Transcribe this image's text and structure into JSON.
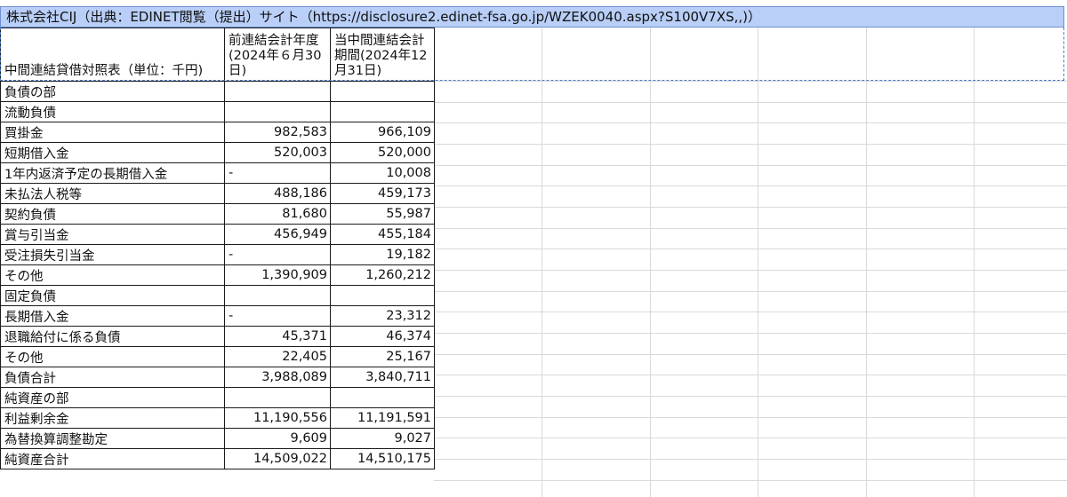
{
  "title": "株式会社CIJ（出典：EDINET閲覧（提出）サイト（https://disclosure2.edinet-fsa.go.jp/WZEK0040.aspx?S100V7XS,,)）",
  "header": {
    "c0": "中間連結貸借対照表（単位：千円)",
    "c1": "前連結会計年度(2024年６月30日)",
    "c2": "当中間連結会計期間(2024年12月31日)"
  },
  "rows": [
    {
      "label": "負債の部",
      "prev": "",
      "curr": ""
    },
    {
      "label": "流動負債",
      "prev": "",
      "curr": ""
    },
    {
      "label": "買掛金",
      "prev": "982,583",
      "curr": "966,109"
    },
    {
      "label": "短期借入金",
      "prev": "520,003",
      "curr": "520,000"
    },
    {
      "label": "1年内返済予定の長期借入金",
      "prev": "-",
      "curr": "10,008"
    },
    {
      "label": "未払法人税等",
      "prev": "488,186",
      "curr": "459,173"
    },
    {
      "label": "契約負債",
      "prev": "81,680",
      "curr": "55,987"
    },
    {
      "label": "賞与引当金",
      "prev": "456,949",
      "curr": "455,184"
    },
    {
      "label": "受注損失引当金",
      "prev": "-",
      "curr": "19,182"
    },
    {
      "label": "その他",
      "prev": "1,390,909",
      "curr": "1,260,212"
    },
    {
      "label": "固定負債",
      "prev": "",
      "curr": ""
    },
    {
      "label": "長期借入金",
      "prev": "-",
      "curr": "23,312"
    },
    {
      "label": "退職給付に係る負債",
      "prev": "45,371",
      "curr": "46,374"
    },
    {
      "label": "その他",
      "prev": "22,405",
      "curr": "25,167"
    },
    {
      "label": "負債合計",
      "prev": "3,988,089",
      "curr": "3,840,711"
    },
    {
      "label": "純資産の部",
      "prev": "",
      "curr": ""
    },
    {
      "label": "利益剰余金",
      "prev": "11,190,556",
      "curr": "11,191,591"
    },
    {
      "label": "為替換算調整勘定",
      "prev": "9,609",
      "curr": "9,027"
    },
    {
      "label": "純資産合計",
      "prev": "14,509,022",
      "curr": "14,510,175"
    }
  ]
}
